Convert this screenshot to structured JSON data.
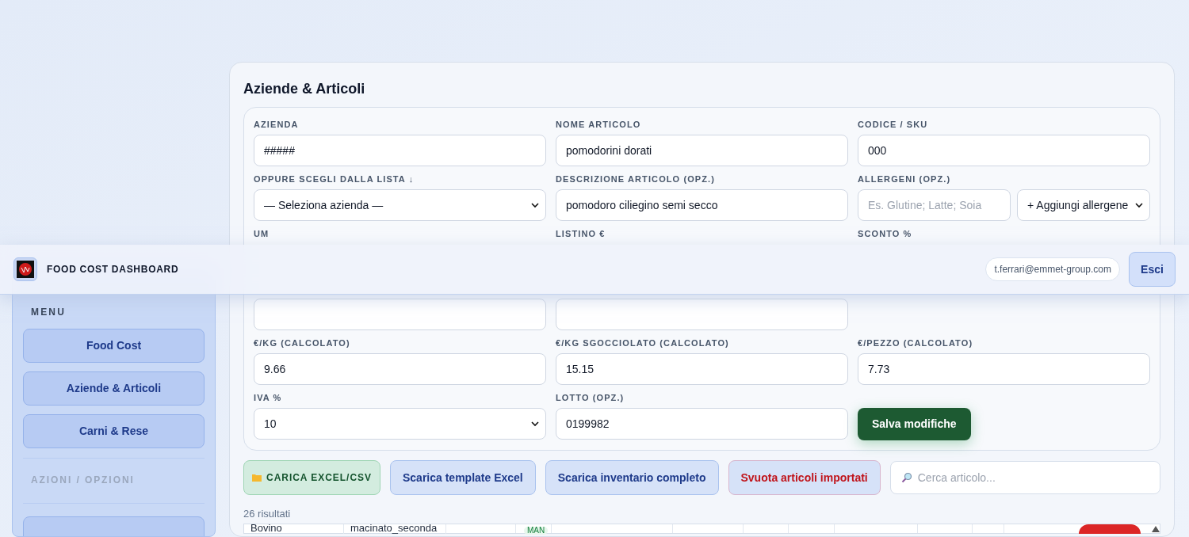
{
  "header": {
    "title": "FOOD COST DASHBOARD",
    "user_email": "t.ferrari@emmet-group.com",
    "logout": "Esci"
  },
  "sidebar": {
    "section_title": "MENU",
    "items": [
      {
        "label": "Food Cost"
      },
      {
        "label": "Aziende & Articoli"
      },
      {
        "label": "Carni & Rese"
      }
    ],
    "actions_title": "AZIONI / OPZIONI"
  },
  "form": {
    "title": "Aziende & Articoli",
    "fields": [
      {
        "kind": "input",
        "label": "AZIENDA",
        "value": "#####"
      },
      {
        "kind": "input",
        "label": "NOME ARTICOLO",
        "value": "pomodorini dorati"
      },
      {
        "kind": "input",
        "label": "CODICE / SKU",
        "value": "000"
      },
      {
        "kind": "select",
        "label": "OPPURE SCEGLI DALLA LISTA ↓",
        "value": "— Seleziona azienda —"
      },
      {
        "kind": "input",
        "label": "DESCRIZIONE ARTICOLO (OPZ.)",
        "value": "pomodoro ciliegino semi secco"
      },
      {
        "kind": "allergens",
        "label": "ALLERGENI (OPZ.)",
        "placeholder": "Es. Glutine; Latte; Soia",
        "value": "+ Aggiungi allergene"
      },
      {
        "kind": "covered",
        "label": "UM"
      },
      {
        "kind": "covered",
        "label": "LISTINO €"
      },
      {
        "kind": "covered",
        "label": "SCONTO %"
      },
      {
        "kind": "input"
      },
      {
        "kind": "input"
      },
      {
        "kind": "empty"
      },
      {
        "kind": "input",
        "label": "€/KG (CALCOLATO)",
        "value": "9.66"
      },
      {
        "kind": "input",
        "label": "€/KG SGOCCIOLATO (CALCOLATO)",
        "value": "15.15"
      },
      {
        "kind": "input",
        "label": "€/PEZZO (CALCOLATO)",
        "value": "7.73"
      },
      {
        "kind": "select",
        "label": "IVA %",
        "value": "10"
      },
      {
        "kind": "input",
        "label": "LOTTO (OPZ.)",
        "value": "0199982"
      },
      {
        "kind": "button",
        "value": "Salva modifiche"
      }
    ]
  },
  "toolbar": {
    "buttons": [
      {
        "kind": "upload",
        "label": "CARICA EXCEL/CSV"
      },
      {
        "kind": "download",
        "label": "Scarica template Excel"
      },
      {
        "kind": "download",
        "label": "Scarica inventario completo"
      },
      {
        "kind": "danger",
        "label": "Svuota articoli importati"
      }
    ],
    "search_placeholder": "Cerca articolo..."
  },
  "results_count": "26 risultati",
  "table": {
    "rows": [
      {
        "column_1": "Bovino",
        "column_2": "macinato_seconda",
        "badge": "MAN"
      }
    ]
  }
}
